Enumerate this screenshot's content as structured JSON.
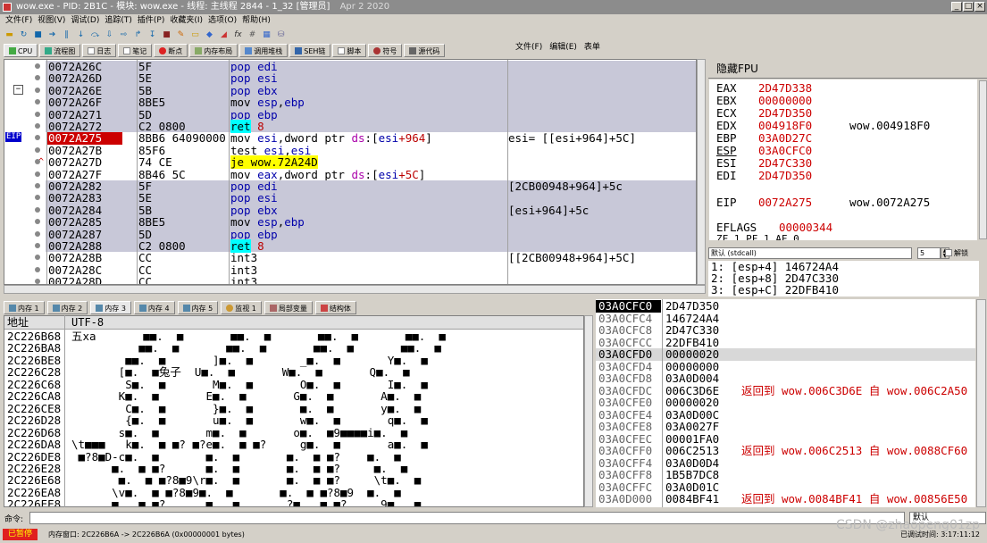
{
  "window": {
    "title": "wow.exe - PID: 2B1C - 模块: wow.exe - 线程: 主线程 2844 - 1_32 [管理员]",
    "date": "Apr 2 2020",
    "controls": [
      "_",
      "□",
      "×"
    ]
  },
  "menu": [
    "文件(F)",
    "视图(V)",
    "调试(D)",
    "追踪(T)",
    "插件(P)",
    "收藏夹(I)",
    "选项(O)",
    "帮助(H)"
  ],
  "overlay_menu": [
    "文件(F)",
    "编辑(E)",
    "表单"
  ],
  "toolbar_icons": [
    "open-icon",
    "restart-icon",
    "close-icon",
    "run-icon",
    "pause-icon",
    "step-into-icon",
    "step-over-icon",
    "trace-into-icon",
    "trace-over-icon",
    "execute-till-return-icon",
    "run-to-user-code-icon",
    "scylla-icon",
    "patch-icon",
    "comment-icon",
    "label-icon",
    "bookmark-icon",
    "function-icon",
    "variable-icon",
    "calculator-icon",
    "database-icon"
  ],
  "tabs_top": [
    {
      "label": "CPU",
      "icon": "cpu-icon",
      "active": true
    },
    {
      "label": "流程图",
      "icon": "graph-icon"
    },
    {
      "label": "日志",
      "icon": "log-icon"
    },
    {
      "label": "笔记",
      "icon": "notes-icon"
    },
    {
      "label": "断点",
      "icon": "breakpoint-icon"
    },
    {
      "label": "内存布局",
      "icon": "memory-map-icon"
    },
    {
      "label": "调用堆栈",
      "icon": "callstack-icon"
    },
    {
      "label": "SEH链",
      "icon": "seh-icon"
    },
    {
      "label": "脚本",
      "icon": "script-icon"
    },
    {
      "label": "符号",
      "icon": "symbol-icon"
    },
    {
      "label": "源代码",
      "icon": "source-icon"
    }
  ],
  "eip_marker": "EIP",
  "disasm": [
    {
      "addr": "0072A26C",
      "hex": "5F",
      "asm": [
        [
          "kw",
          "pop "
        ],
        [
          "reg",
          "edi"
        ]
      ],
      "cmt": "",
      "grey": true
    },
    {
      "addr": "0072A26D",
      "hex": "5E",
      "asm": [
        [
          "kw",
          "pop "
        ],
        [
          "reg",
          "esi"
        ]
      ],
      "cmt": "",
      "grey": true
    },
    {
      "addr": "0072A26E",
      "hex": "5B",
      "asm": [
        [
          "kw",
          "pop "
        ],
        [
          "reg",
          "ebx"
        ]
      ],
      "cmt": "",
      "grey": true
    },
    {
      "addr": "0072A26F",
      "hex": "8BE5",
      "asm": [
        [
          "",
          "mov "
        ],
        [
          "reg",
          "esp"
        ],
        [
          "",
          ","
        ],
        [
          "reg",
          "ebp"
        ]
      ],
      "cmt": "",
      "grey": true
    },
    {
      "addr": "0072A271",
      "hex": "5D",
      "asm": [
        [
          "kw",
          "pop "
        ],
        [
          "reg",
          "ebp"
        ]
      ],
      "cmt": "",
      "grey": true
    },
    {
      "addr": "0072A272",
      "hex": "C2 0800",
      "asm": [
        [
          "retb",
          "ret"
        ],
        [
          "num",
          " 8"
        ]
      ],
      "cmt": "",
      "grey": true
    },
    {
      "addr": "0072A275",
      "hex": "8BB6 64090000",
      "asm": [
        [
          "",
          "mov "
        ],
        [
          "reg",
          "esi"
        ],
        [
          "",
          ",dword ptr "
        ],
        [
          "kwp",
          "ds"
        ],
        [
          "",
          ":["
        ],
        [
          "reg",
          "esi"
        ],
        [
          "num",
          "+964"
        ],
        [
          "",
          "]"
        ]
      ],
      "cmt": "esi= [[esi+964]+5C]",
      "grey": false,
      "eip": true
    },
    {
      "addr": "0072A27B",
      "hex": "85F6",
      "asm": [
        [
          "",
          "test "
        ],
        [
          "reg",
          "esi"
        ],
        [
          "",
          ","
        ],
        [
          "reg",
          "esi"
        ]
      ],
      "cmt": "",
      "grey": false
    },
    {
      "addr": "0072A27D",
      "hex": "74 CE",
      "asm": [
        [
          "jeh",
          "je wow.72A24D"
        ]
      ],
      "cmt": "",
      "grey": false,
      "jmp": true
    },
    {
      "addr": "0072A27F",
      "hex": "8B46 5C",
      "asm": [
        [
          "",
          "mov "
        ],
        [
          "reg",
          "eax"
        ],
        [
          "",
          ",dword ptr "
        ],
        [
          "kwp",
          "ds"
        ],
        [
          "",
          ":["
        ],
        [
          "reg",
          "esi"
        ],
        [
          "num",
          "+5C"
        ],
        [
          "",
          "]"
        ]
      ],
      "cmt": "",
      "grey": false
    },
    {
      "addr": "0072A282",
      "hex": "5F",
      "asm": [
        [
          "kw",
          "pop "
        ],
        [
          "reg",
          "edi"
        ]
      ],
      "cmt": "[2CB00948+964]+5c",
      "grey": true
    },
    {
      "addr": "0072A283",
      "hex": "5E",
      "asm": [
        [
          "kw",
          "pop "
        ],
        [
          "reg",
          "esi"
        ]
      ],
      "cmt": "",
      "grey": true
    },
    {
      "addr": "0072A284",
      "hex": "5B",
      "asm": [
        [
          "kw",
          "pop "
        ],
        [
          "reg",
          "ebx"
        ]
      ],
      "cmt": "[esi+964]+5c",
      "grey": true
    },
    {
      "addr": "0072A285",
      "hex": "8BE5",
      "asm": [
        [
          "",
          "mov "
        ],
        [
          "reg",
          "esp"
        ],
        [
          "",
          ","
        ],
        [
          "reg",
          "ebp"
        ]
      ],
      "cmt": "",
      "grey": true
    },
    {
      "addr": "0072A287",
      "hex": "5D",
      "asm": [
        [
          "kw",
          "pop "
        ],
        [
          "reg",
          "ebp"
        ]
      ],
      "cmt": "",
      "grey": true
    },
    {
      "addr": "0072A288",
      "hex": "C2 0800",
      "asm": [
        [
          "retb",
          "ret"
        ],
        [
          "num",
          " 8"
        ]
      ],
      "cmt": "",
      "grey": true
    },
    {
      "addr": "0072A28B",
      "hex": "CC",
      "asm": [
        [
          "",
          "int3"
        ]
      ],
      "cmt": "[[2CB00948+964]+5C]",
      "grey": false
    },
    {
      "addr": "0072A28C",
      "hex": "CC",
      "asm": [
        [
          "",
          "int3"
        ]
      ],
      "cmt": "",
      "grey": false
    },
    {
      "addr": "0072A28D",
      "hex": "CC",
      "asm": [
        [
          "",
          "int3"
        ]
      ],
      "cmt": "",
      "grey": false
    }
  ],
  "registers": {
    "header": "隐藏FPU",
    "rows": [
      {
        "name": "EAX",
        "value": "2D47D338",
        "comment": ""
      },
      {
        "name": "EBX",
        "value": "00000000",
        "comment": ""
      },
      {
        "name": "ECX",
        "value": "2D47D350",
        "comment": ""
      },
      {
        "name": "EDX",
        "value": "004918F0",
        "comment": "wow.004918F0"
      },
      {
        "name": "EBP",
        "value": "03A0D27C",
        "comment": ""
      },
      {
        "name": "ESP",
        "value": "03A0CFC0",
        "comment": ""
      },
      {
        "name": "ESI",
        "value": "2D47C330",
        "comment": ""
      },
      {
        "name": "EDI",
        "value": "2D47D350",
        "comment": ""
      }
    ],
    "eip": {
      "name": "EIP",
      "value": "0072A275",
      "comment": "wow.0072A275"
    },
    "eflags": {
      "name": "EFLAGS",
      "value": "00000344"
    },
    "flags_partial": "ZF 1   PF 1   AF 0"
  },
  "callconv": {
    "selected": "默认 (stdcall)",
    "count": "5",
    "unlock_label": "解锁"
  },
  "call_args": [
    "1: [esp+4] 146724A4",
    "2: [esp+8] 2D47C330",
    "3: [esp+C] 22DFB410"
  ],
  "tabs_mem": [
    {
      "label": "内存 1",
      "icon": "memory-icon"
    },
    {
      "label": "内存 2",
      "icon": "memory-icon"
    },
    {
      "label": "内存 3",
      "icon": "memory-icon",
      "active": true
    },
    {
      "label": "内存 4",
      "icon": "memory-icon"
    },
    {
      "label": "内存 5",
      "icon": "memory-icon"
    },
    {
      "label": "监视 1",
      "icon": "watch-icon"
    },
    {
      "label": "局部变量",
      "icon": "locals-icon"
    },
    {
      "label": "结构体",
      "icon": "struct-icon"
    }
  ],
  "dump": {
    "headers": [
      "地址",
      "UTF-8"
    ],
    "rows": [
      {
        "addr": "2C226B68",
        "text": "五xa       ■■.  ■       ■■.  ■       ■■.  ■       ■■.  ■"
      },
      {
        "addr": "2C226BA8",
        "text": "          ■■.  ■       ■■.  ■       ■■.  ■       ■■.  ■"
      },
      {
        "addr": "2C226BE8",
        "text": "        ■■.  ■       ]■.  ■       _■.  ■       Y■.  ■"
      },
      {
        "addr": "2C226C28",
        "text": "       [■.  ■兔子  U■.  ■       W■.  ■       Q■.  ■"
      },
      {
        "addr": "2C226C68",
        "text": "        S■.  ■       M■.  ■       O■.  ■       I■.  ■"
      },
      {
        "addr": "2C226CA8",
        "text": "       K■.  ■       E■.  ■       G■.  ■       A■.  ■"
      },
      {
        "addr": "2C226CE8",
        "text": "        C■.  ■       }■.  ■       ■.  ■       y■.  ■"
      },
      {
        "addr": "2C226D28",
        "text": "        {■.  ■       u■.  ■       w■.  ■       q■.  ■"
      },
      {
        "addr": "2C226D68",
        "text": "       s■.  ■       m■.  ■       o■.  ■9■■■■i■.  ■"
      },
      {
        "addr": "2C226DA8",
        "text": "\\t■■■   k■.  ■ ■? ■?e■.  ■ ■?     g■.  ■       a■.  ■"
      },
      {
        "addr": "2C226DE8",
        "text": " ■?8■D-c■.  ■       ■.  ■       ■.  ■ ■?    ■.  ■"
      },
      {
        "addr": "2C226E28",
        "text": "      ■.  ■ ■?      ■.  ■       ■.  ■ ■?     ■.  ■"
      },
      {
        "addr": "2C226E68",
        "text": "       ■.  ■ ■?8■9\\r■.  ■       ■.  ■ ■?     \\t■.  ■"
      },
      {
        "addr": "2C226EA8",
        "text": "      \\v■.  ■ ■?8■9■.  ■       ■.  ■ ■?8■9  ■.  ■"
      },
      {
        "addr": "2C226EE8",
        "text": "      ■.  ■ ■?      ■.  ■       ?■.  ■ ■?     9■.  ■"
      }
    ]
  },
  "stack": [
    {
      "addr": "03A0CFC0",
      "value": "2D47D350",
      "comment": "",
      "top": true
    },
    {
      "addr": "03A0CFC4",
      "value": "146724A4",
      "comment": ""
    },
    {
      "addr": "03A0CFC8",
      "value": "2D47C330",
      "comment": ""
    },
    {
      "addr": "03A0CFCC",
      "value": "22DFB410",
      "comment": ""
    },
    {
      "addr": "03A0CFD0",
      "value": "00000020",
      "comment": "",
      "hl": true
    },
    {
      "addr": "03A0CFD4",
      "value": "00000000",
      "comment": ""
    },
    {
      "addr": "03A0CFD8",
      "value": "03A0D004",
      "comment": ""
    },
    {
      "addr": "03A0CFDC",
      "value": "006C3D6E",
      "comment": "返回到 wow.006C3D6E 自 wow.006C2A50"
    },
    {
      "addr": "03A0CFE0",
      "value": "00000020",
      "comment": ""
    },
    {
      "addr": "03A0CFE4",
      "value": "03A0D00C",
      "comment": ""
    },
    {
      "addr": "03A0CFE8",
      "value": "03A0027F",
      "comment": ""
    },
    {
      "addr": "03A0CFEC",
      "value": "00001FA0",
      "comment": ""
    },
    {
      "addr": "03A0CFF0",
      "value": "006C2513",
      "comment": "返回到 wow.006C2513 自 wow.0088CF60"
    },
    {
      "addr": "03A0CFF4",
      "value": "03A0D0D4",
      "comment": ""
    },
    {
      "addr": "03A0CFF8",
      "value": "1B5B7DC8",
      "comment": ""
    },
    {
      "addr": "03A0CFFC",
      "value": "03A0D01C",
      "comment": ""
    },
    {
      "addr": "03A0D000",
      "value": "0084BF41",
      "comment": "返回到 wow.0084BF41 自 wow.00856E50"
    }
  ],
  "command": {
    "label": "命令:",
    "value": "",
    "default": "默认"
  },
  "status": {
    "state": "已暂停",
    "message": "内存窗口: 2C226B6A -> 2C226B6A (0x00000001 bytes)",
    "runtime": "已调试时间: 3:17:11:12"
  },
  "watermark": "CSDN @zhaopeng01zp",
  "colors": {
    "accent": "#0000aa",
    "eip": "#0000cc",
    "paused": "#e02020",
    "register_value": "#cc0000"
  }
}
